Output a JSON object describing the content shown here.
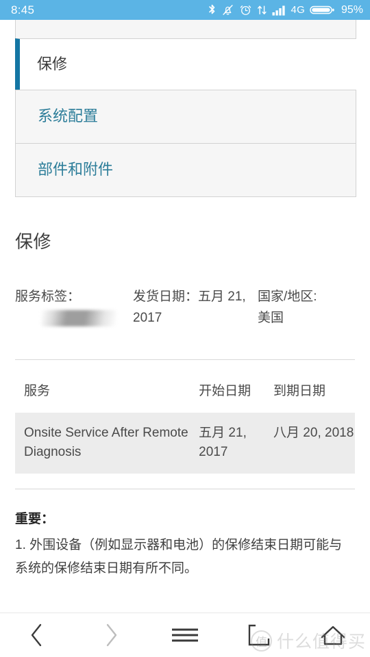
{
  "status_bar": {
    "clock": "8:45",
    "network_label": "4G",
    "battery_percent": "95%",
    "icons": [
      "bluetooth-icon",
      "mute-bell-icon",
      "alarm-clock-icon",
      "data-transfer-icon",
      "signal-bars-icon",
      "battery-icon"
    ],
    "background_color": "#5BB4E5"
  },
  "taplist": {
    "items": [
      {
        "label": "",
        "active": false,
        "partial": true
      },
      {
        "label": "保修",
        "active": true,
        "partial": false
      },
      {
        "label": "系统配置",
        "active": false,
        "partial": false
      },
      {
        "label": "部件和附件",
        "active": false,
        "partial": false
      }
    ],
    "accent_color": "#1476A4",
    "link_color": "#2C7D99"
  },
  "main": {
    "section_title": "保修",
    "meta": {
      "service_tag_label": "服务标签：",
      "service_tag_value": "",
      "ship_date_label": "发货日期：",
      "ship_date_value": "五月 21, 2017",
      "region_label": "国家/地区:",
      "region_value": "美国"
    },
    "table": {
      "headers": [
        "服务",
        "开始日期",
        "到期日期"
      ],
      "rows": [
        {
          "service": "Onsite Service After Remote Diagnosis",
          "start_date": "五月 21, 2017",
          "end_date": "八月 20, 2018"
        }
      ],
      "row_background": "#ECECEC"
    },
    "notes": {
      "title": "重要：",
      "body": "1. 外围设备（例如显示器和电池）的保修结束日期可能与系统的保修结束日期有所不同。"
    }
  },
  "navbar": {
    "buttons": [
      {
        "name": "back-button",
        "icon": "chevron-left-icon",
        "enabled": true
      },
      {
        "name": "forward-button",
        "icon": "chevron-right-icon",
        "enabled": false
      },
      {
        "name": "menu-button",
        "icon": "hamburger-menu-icon",
        "enabled": true
      },
      {
        "name": "tabs-button",
        "icon": "tabs-window-icon",
        "enabled": true
      },
      {
        "name": "home-button",
        "icon": "home-icon",
        "enabled": true
      }
    ]
  },
  "watermark": {
    "badge": "值",
    "text": "什么值得买"
  }
}
